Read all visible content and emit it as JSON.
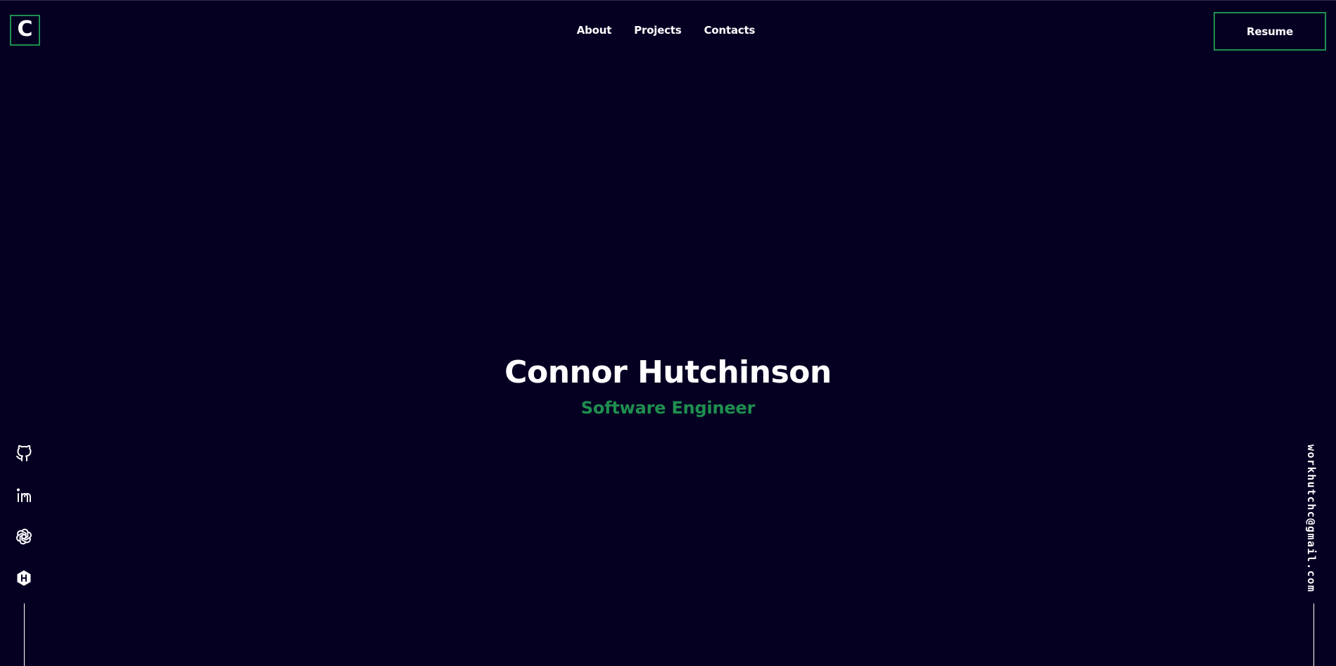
{
  "header": {
    "logo_letter": "C",
    "nav": [
      {
        "label": "About"
      },
      {
        "label": "Projects"
      },
      {
        "label": "Contacts"
      }
    ],
    "resume_label": "Resume"
  },
  "hero": {
    "name": "Connor Hutchinson",
    "title": "Software Engineer"
  },
  "socials": [
    {
      "icon": "github-icon"
    },
    {
      "icon": "linkedin-icon"
    },
    {
      "icon": "openai-icon"
    },
    {
      "icon": "hackerrank-icon"
    }
  ],
  "contact": {
    "email": "workhutchc@gmail.com"
  },
  "colors": {
    "background": "#050022",
    "accent": "#1e8f4e",
    "text": "#ffffff"
  }
}
